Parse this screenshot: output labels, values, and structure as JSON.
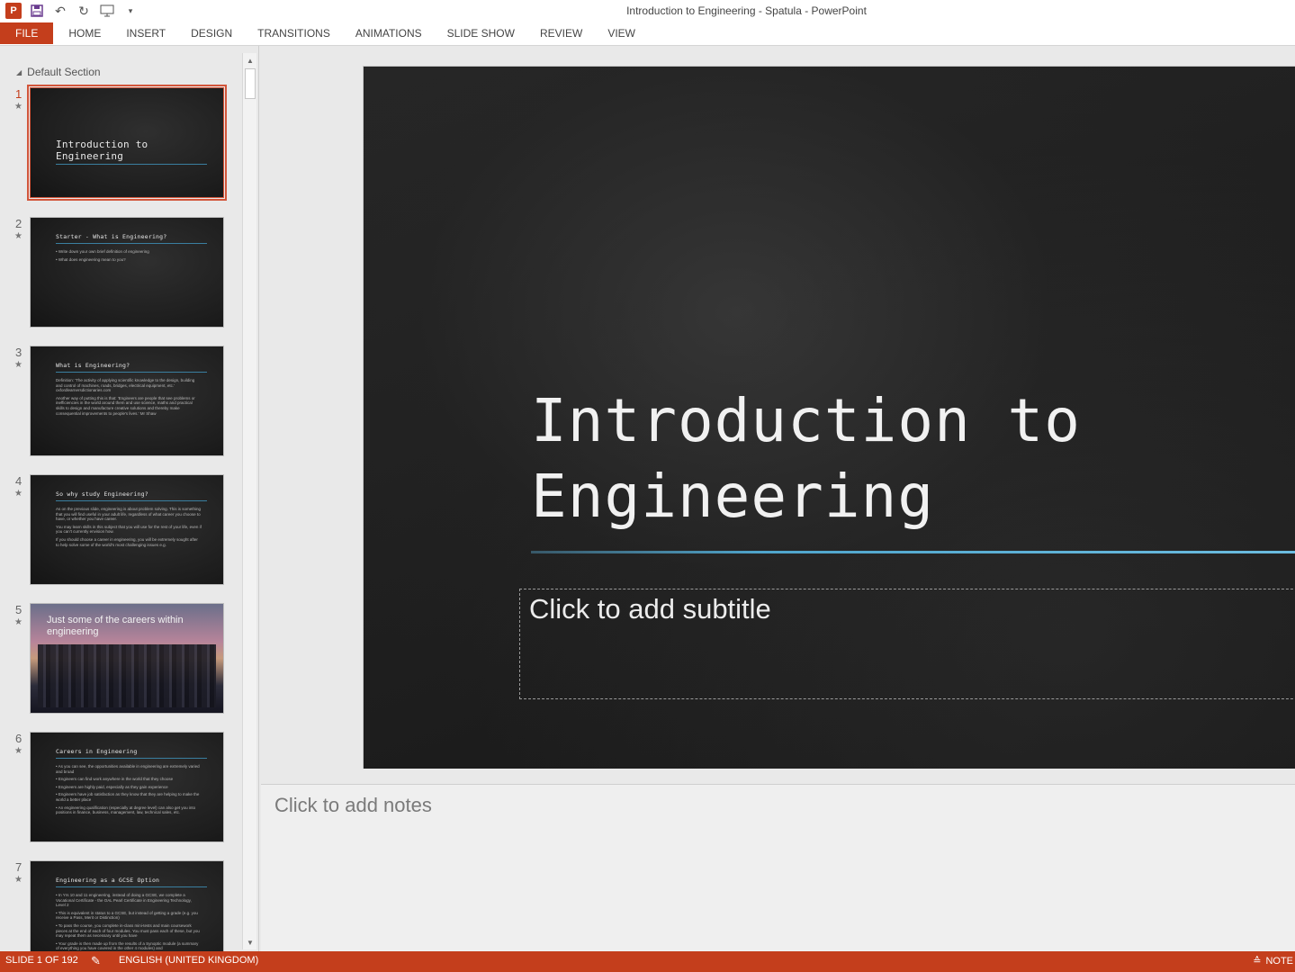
{
  "window": {
    "title": "Introduction to Engineering - Spatula - PowerPoint",
    "app_icon": "P"
  },
  "qat": {
    "icons": [
      "save-icon",
      "undo-icon",
      "redo-icon",
      "slideshow-from-start-icon",
      "customize-qat-icon"
    ]
  },
  "ribbon": {
    "tabs": [
      "FILE",
      "HOME",
      "INSERT",
      "DESIGN",
      "TRANSITIONS",
      "ANIMATIONS",
      "SLIDE SHOW",
      "REVIEW",
      "VIEW"
    ]
  },
  "sidebar": {
    "section_name": "Default Section",
    "slides": [
      {
        "num": "1",
        "title": "Introduction to\nEngineering",
        "body": []
      },
      {
        "num": "2",
        "title": "Starter - What is Engineering?",
        "body": [
          "• Write down your own brief definition of engineering",
          "• What does engineering mean to you?"
        ]
      },
      {
        "num": "3",
        "title": "What is Engineering?",
        "body": [
          "Definition: 'The activity of applying scientific knowledge to the design, building and control of machines, roads, bridges, electrical equipment, etc.' oxfordlearnersdictionaries.com",
          "Another way of putting this is that: 'Engineers are people that see problems or inefficiencies in the world around them and use science, maths and practical skills to design and manufacture creative solutions and thereby make consequential improvements to people's lives.' Mr Shaw"
        ]
      },
      {
        "num": "4",
        "title": "So why study Engineering?",
        "body": [
          "As on the previous slide, engineering is about problem solving. This is something that you will find useful in your adult life, regardless of what career you choose to have, or whether you have career.",
          "You may learn skills in this subject that you will use for the rest of your life, even if you can't currently envision how.",
          "If you should choose a career in engineering, you will be extremely sought after to help solve some of the world's most challenging issues e.g."
        ]
      },
      {
        "num": "5",
        "title": "Just some of the careers within engineering",
        "body": []
      },
      {
        "num": "6",
        "title": "Careers in Engineering",
        "body": [
          "• As you can see, the opportunities available in engineering are extremely varied and broad",
          "• Engineers can find work anywhere in the world that they choose",
          "• Engineers are highly paid, especially as they gain experience",
          "• Engineers have job satisfaction as they know that they are helping to make the world a better place",
          "• An engineering qualification (especially at degree level) can also get you into positions in finance, business, management, law, technical sales, etc."
        ]
      },
      {
        "num": "7",
        "title": "Engineering as a GCSE Option",
        "body": [
          "• In Yrs 10 and 11 engineering, instead of doing a GCSE, we complete a Vocational Certificate - the OAL Pearl Certificate in Engineering Technology, Level 2",
          "• This is equivalent in status to a GCSE, but instead of getting a grade (e.g. you receive a Pass, Merit or Distinction)",
          "• To pass the course, you complete in-class mini-tests and main coursework pieces at the end of each of four modules. You must pass each of these, but you may repeat them as necessary until you have",
          "• Your grade is then made up from the results of a Synoptic module (a summary of everything you have covered in the other 4 modules) and"
        ]
      }
    ]
  },
  "slide": {
    "title": "Introduction to\nEngineering",
    "subtitle_placeholder": "Click to add subtitle"
  },
  "notes": {
    "placeholder": "Click to add notes"
  },
  "status": {
    "slide_count": "SLIDE 1 OF 192",
    "language": "ENGLISH (UNITED KINGDOM)",
    "notes_label": "NOTE"
  }
}
